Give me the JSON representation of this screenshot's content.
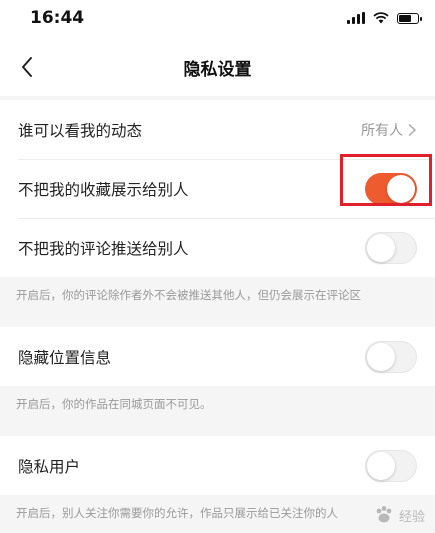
{
  "status_bar": {
    "time": "16:44"
  },
  "nav": {
    "title": "隐私设置"
  },
  "settings": {
    "who_can_see": {
      "label": "谁可以看我的动态",
      "value": "所有人"
    },
    "hide_favorites": {
      "label": "不把我的收藏展示给别人",
      "enabled": true
    },
    "hide_comments": {
      "label": "不把我的评论推送给别人",
      "enabled": false,
      "note": "开启后，你的评论除作者外不会被推送其他人，但仍会展示在评论区"
    },
    "hide_location": {
      "label": "隐藏位置信息",
      "enabled": false,
      "note": "开启后，你的作品在同城页面不可见。"
    },
    "private_user": {
      "label": "隐私用户",
      "enabled": false,
      "note": "开启后，别人关注你需要你的允许，作品只展示给已关注你的人"
    }
  },
  "colors": {
    "toggle_on": "#ee5b2f",
    "highlight": "#e0212b"
  },
  "watermark": {
    "text": "经验"
  }
}
